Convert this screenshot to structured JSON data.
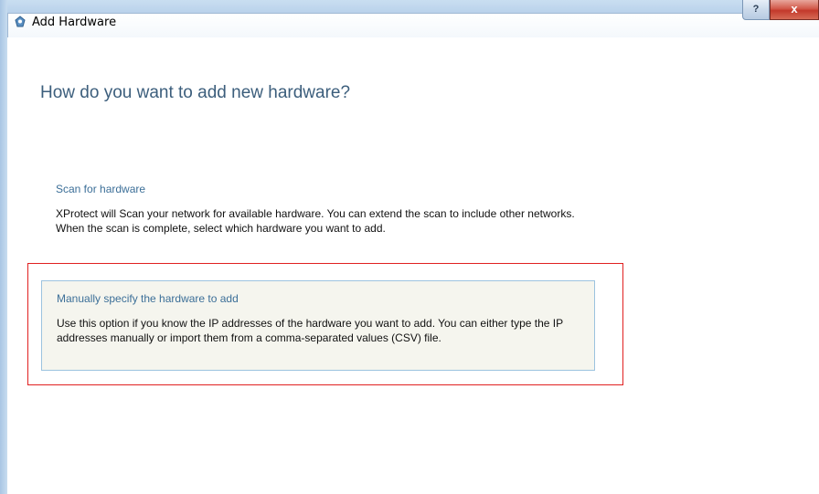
{
  "window": {
    "title": "Add Hardware",
    "help_label": "?",
    "close_label": "x"
  },
  "page": {
    "heading": "How do you want to add new hardware?"
  },
  "options": [
    {
      "title": "Scan for hardware",
      "description": "XProtect will Scan your network for available hardware. You can extend the scan to include other networks. When the scan is complete, select which hardware you want to add.",
      "selected": false
    },
    {
      "title": "Manually specify the hardware to add",
      "description": "Use this option if you know the IP addresses of the hardware you want to add. You can either type the IP addresses manually or import them from a comma-separated values (CSV) file.",
      "selected": true
    }
  ],
  "colors": {
    "heading": "#3c5e7c",
    "option_title": "#3c6f98",
    "selected_bg": "#f5f5ee",
    "selected_border": "#9cc3df",
    "highlight": "#e02020"
  }
}
